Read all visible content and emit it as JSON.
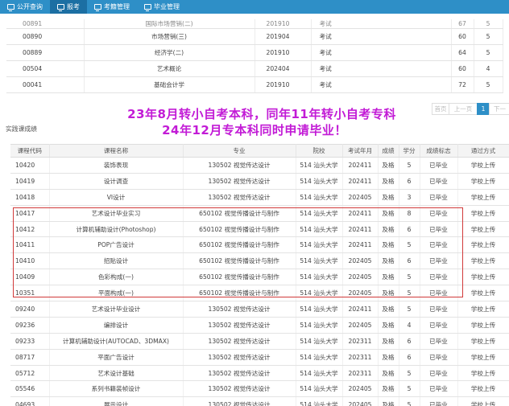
{
  "nav": {
    "items": [
      {
        "label": "公开查询",
        "active": false
      },
      {
        "label": "报考",
        "active": true
      },
      {
        "label": "考籍管理",
        "active": false
      },
      {
        "label": "毕业管理",
        "active": false
      }
    ]
  },
  "top_table": {
    "rows": [
      [
        "00891",
        "国际市场营销(二)",
        "201910",
        "考试",
        "67",
        "5"
      ],
      [
        "00890",
        "市场营销(三)",
        "201904",
        "考试",
        "60",
        "5"
      ],
      [
        "00889",
        "经济学(二)",
        "201910",
        "考试",
        "64",
        "5"
      ],
      [
        "00504",
        "艺术概论",
        "202404",
        "考试",
        "60",
        "4"
      ],
      [
        "00041",
        "基础会计学",
        "201910",
        "考试",
        "72",
        "5"
      ]
    ]
  },
  "pagination": {
    "prev_short": "首页",
    "prev": "上一页",
    "current": "1",
    "next": "下一"
  },
  "annotation": {
    "line1": "23年8月转小自考本科，同年11年转小自考专科",
    "line2": "24年12月专本科同时申请毕业！"
  },
  "section_title": "实践课成绩",
  "bottom_table": {
    "headers": [
      "课程代码",
      "课程名称",
      "专业",
      "院校",
      "考试年月",
      "成绩",
      "学分",
      "成绩标志",
      "通过方式"
    ],
    "rows": [
      [
        "10420",
        "装饰表现",
        "130502 视觉传达设计",
        "514 汕头大学",
        "202411",
        "及格",
        "5",
        "已毕业",
        "学校上传"
      ],
      [
        "10419",
        "设计调查",
        "130502 视觉传达设计",
        "514 汕头大学",
        "202411",
        "及格",
        "6",
        "已毕业",
        "学校上传"
      ],
      [
        "10418",
        "VI设计",
        "130502 视觉传达设计",
        "514 汕头大学",
        "202405",
        "及格",
        "3",
        "已毕业",
        "学校上传"
      ],
      [
        "10417",
        "艺术设计毕业实习",
        "650102 视觉传播设计与制作",
        "514 汕头大学",
        "202411",
        "及格",
        "8",
        "已毕业",
        "学校上传"
      ],
      [
        "10412",
        "计算机辅助设计(Photoshop)",
        "650102 视觉传播设计与制作",
        "514 汕头大学",
        "202411",
        "及格",
        "6",
        "已毕业",
        "学校上传"
      ],
      [
        "10411",
        "POP广告设计",
        "650102 视觉传播设计与制作",
        "514 汕头大学",
        "202411",
        "及格",
        "5",
        "已毕业",
        "学校上传"
      ],
      [
        "10410",
        "招贴设计",
        "650102 视觉传播设计与制作",
        "514 汕头大学",
        "202405",
        "及格",
        "6",
        "已毕业",
        "学校上传"
      ],
      [
        "10409",
        "色彩构成(一)",
        "650102 视觉传播设计与制作",
        "514 汕头大学",
        "202405",
        "及格",
        "5",
        "已毕业",
        "学校上传"
      ],
      [
        "10351",
        "平面构成(一)",
        "650102 视觉传播设计与制作",
        "514 汕头大学",
        "202405",
        "及格",
        "5",
        "已毕业",
        "学校上传"
      ],
      [
        "09240",
        "艺术设计毕业设计",
        "130502 视觉传达设计",
        "514 汕头大学",
        "202411",
        "及格",
        "5",
        "已毕业",
        "学校上传"
      ],
      [
        "09236",
        "编排设计",
        "130502 视觉传达设计",
        "514 汕头大学",
        "202405",
        "及格",
        "4",
        "已毕业",
        "学校上传"
      ],
      [
        "09233",
        "计算机辅助设计(AUTOCAD、3DMAX)",
        "130502 视觉传达设计",
        "514 汕头大学",
        "202311",
        "及格",
        "6",
        "已毕业",
        "学校上传"
      ],
      [
        "08717",
        "平面广告设计",
        "130502 视觉传达设计",
        "514 汕头大学",
        "202311",
        "及格",
        "6",
        "已毕业",
        "学校上传"
      ],
      [
        "05712",
        "艺术设计基础",
        "130502 视觉传达设计",
        "514 汕头大学",
        "202311",
        "及格",
        "5",
        "已毕业",
        "学校上传"
      ],
      [
        "05546",
        "系列书籍装帧设计",
        "130502 视觉传达设计",
        "514 汕头大学",
        "202405",
        "及格",
        "5",
        "已毕业",
        "学校上传"
      ],
      [
        "04693",
        "展示设计",
        "130502 视觉传达设计",
        "514 汕头大学",
        "202405",
        "及格",
        "5",
        "已毕业",
        "学校上传"
      ]
    ]
  },
  "colors": {
    "nav_bg": "#2e8fc7",
    "nav_active": "#1c6fa3",
    "annotation": "#c21bd6",
    "highlight_border": "#d13a3a"
  }
}
